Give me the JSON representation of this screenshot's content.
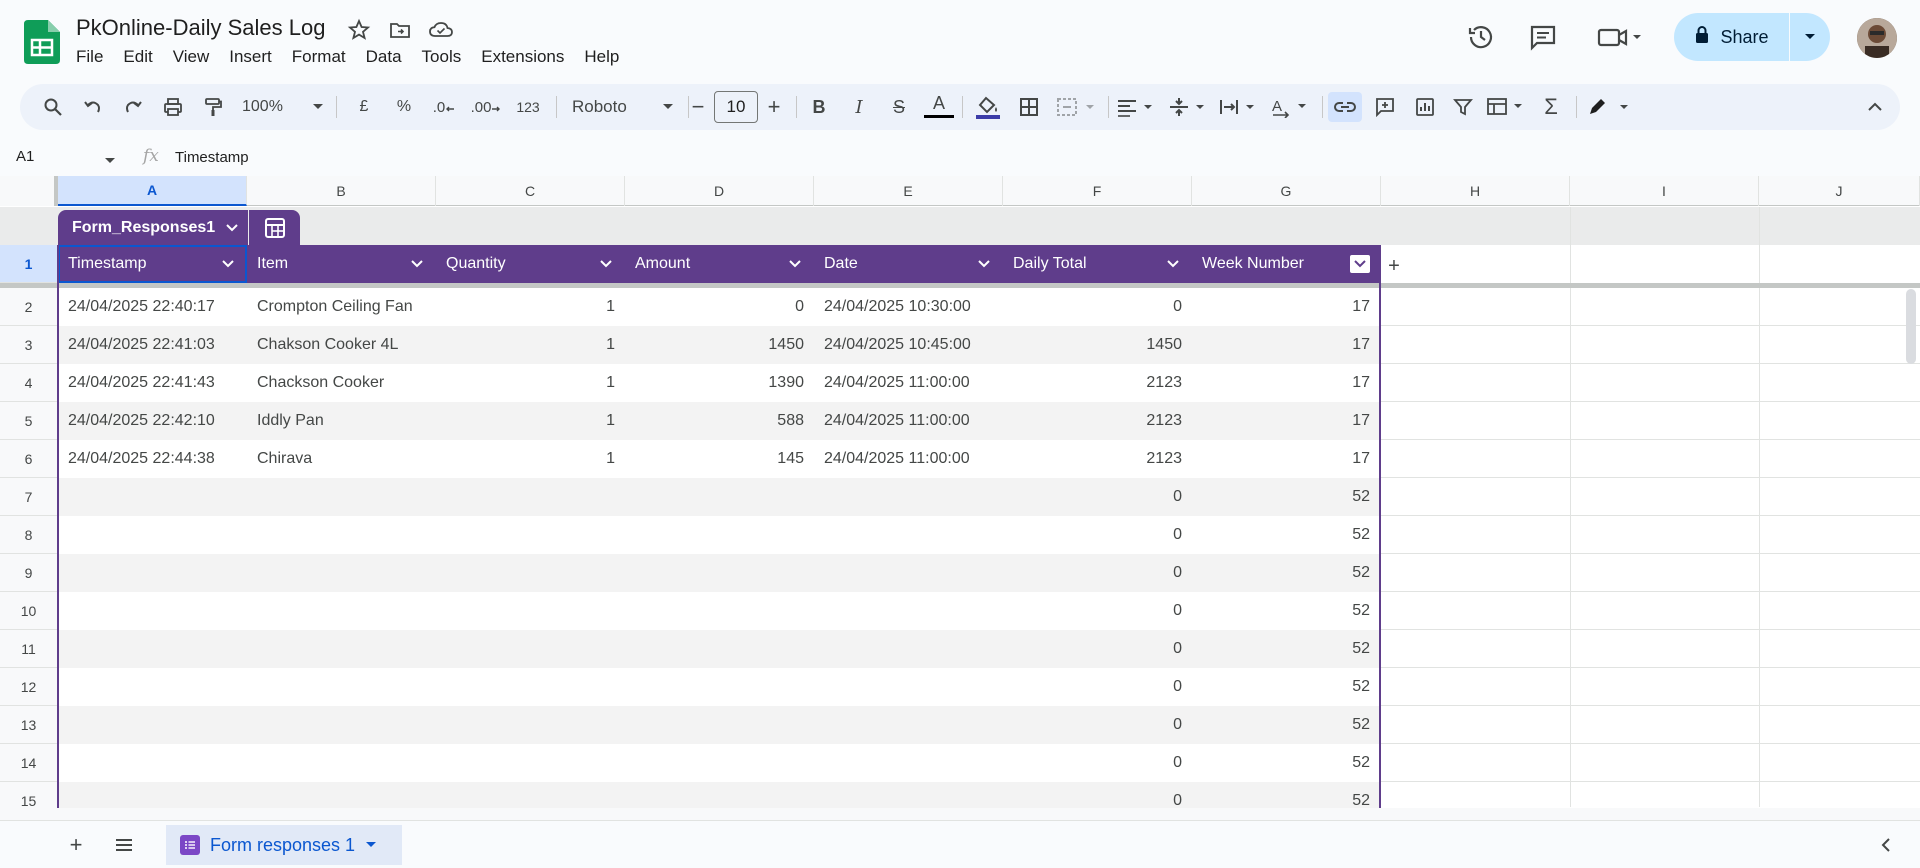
{
  "app": {
    "title": "PkOnline-Daily Sales Log",
    "menu": [
      "File",
      "Edit",
      "View",
      "Insert",
      "Format",
      "Data",
      "Tools",
      "Extensions",
      "Help"
    ],
    "share_label": "Share"
  },
  "toolbar": {
    "zoom": "100%",
    "currency": "£",
    "percent": "%",
    "dec_decrease": ".0",
    "dec_increase": ".00",
    "more_formats": "123",
    "font": "Roboto",
    "font_size": "10",
    "bold": "B",
    "italic": "I",
    "strike": "S",
    "text_color": "A",
    "minus": "−",
    "plus": "+",
    "sigma": "Σ"
  },
  "formula": {
    "cell_ref": "A1",
    "fx": "fx",
    "content": "Timestamp"
  },
  "grid": {
    "columns": [
      "A",
      "B",
      "C",
      "D",
      "E",
      "F",
      "G",
      "H",
      "I",
      "J"
    ],
    "table_name": "Form_Responses1",
    "headers": [
      "Timestamp",
      "Item",
      "Quantity",
      "Amount",
      "Date",
      "Daily Total",
      "Week Number"
    ],
    "row_numbers": [
      "1",
      "2",
      "3",
      "4",
      "5",
      "6",
      "7",
      "8",
      "9",
      "10",
      "11",
      "12",
      "13",
      "14",
      "15"
    ],
    "rows": [
      [
        "24/04/2025 22:40:17",
        "Crompton Ceiling Fan",
        "1",
        "0",
        "24/04/2025 10:30:00",
        "0",
        "17"
      ],
      [
        "24/04/2025 22:41:03",
        "Chakson Cooker 4L",
        "1",
        "1450",
        "24/04/2025 10:45:00",
        "1450",
        "17"
      ],
      [
        "24/04/2025 22:41:43",
        "Chackson Cooker",
        "1",
        "1390",
        "24/04/2025 11:00:00",
        "2123",
        "17"
      ],
      [
        "24/04/2025 22:42:10",
        "Iddly Pan",
        "1",
        "588",
        "24/04/2025 11:00:00",
        "2123",
        "17"
      ],
      [
        "24/04/2025 22:44:38",
        "Chirava",
        "1",
        "145",
        "24/04/2025 11:00:00",
        "2123",
        "17"
      ],
      [
        "",
        "",
        "",
        "",
        "",
        "0",
        "52"
      ],
      [
        "",
        "",
        "",
        "",
        "",
        "0",
        "52"
      ],
      [
        "",
        "",
        "",
        "",
        "",
        "0",
        "52"
      ],
      [
        "",
        "",
        "",
        "",
        "",
        "0",
        "52"
      ],
      [
        "",
        "",
        "",
        "",
        "",
        "0",
        "52"
      ],
      [
        "",
        "",
        "",
        "",
        "",
        "0",
        "52"
      ],
      [
        "",
        "",
        "",
        "",
        "",
        "0",
        "52"
      ],
      [
        "",
        "",
        "",
        "",
        "",
        "0",
        "52"
      ],
      [
        "",
        "",
        "",
        "",
        "",
        "0",
        "52"
      ]
    ]
  },
  "sheets": {
    "active": "Form responses 1"
  },
  "colors": {
    "table_header": "#5f3d8b",
    "accent": "#0b57d0",
    "share_bg": "#c2e7ff",
    "sheets_green": "#0f9d58"
  }
}
